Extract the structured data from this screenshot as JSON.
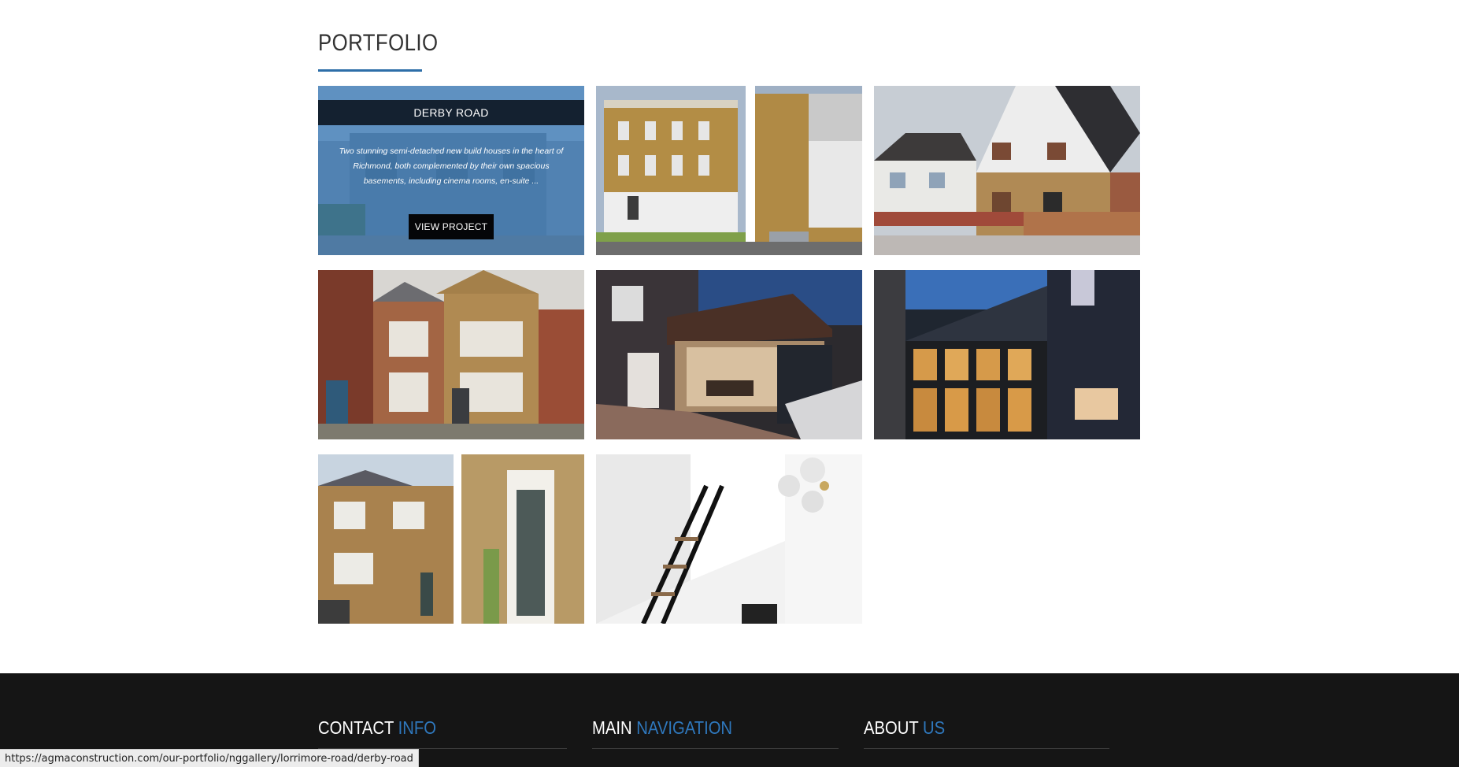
{
  "portfolio": {
    "title": "PORTFOLIO",
    "featured": {
      "title": "DERBY ROAD",
      "description": "Two stunning semi-detached new build houses in the heart of Richmond, both complemented by their own spacious basements, including cinema rooms, en-suite ...",
      "button_label": "VIEW PROJECT"
    }
  },
  "footer": {
    "contact": {
      "word1": "CONTACT",
      "word2": "INFO"
    },
    "navigation": {
      "word1": "MAIN",
      "word2": "NAVIGATION"
    },
    "about": {
      "word1": "ABOUT",
      "word2": "US"
    }
  },
  "status_bar": {
    "url": "https://agmaconstruction.com/our-portfolio/nggallery/lorrimore-road/derby-road"
  },
  "colors": {
    "accent": "#2f78bd",
    "underline": "#2d6ea8",
    "footer_bg": "#151515"
  }
}
